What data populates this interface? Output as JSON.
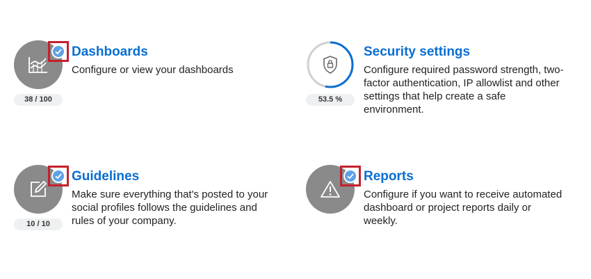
{
  "colors": {
    "accent": "#0a6ed1",
    "badge_gray": "#8a8a8a",
    "check_blue": "#5ea2e6",
    "highlight_red": "#c4202e",
    "progress_track": "#d0d0d0"
  },
  "cards": [
    {
      "title": "Dashboards",
      "description": "Configure or view your dashboards",
      "progress_label": "38 / 100",
      "icon": "area-chart-icon",
      "checked": true
    },
    {
      "title": "Security settings",
      "description": "Configure required password strength, two-factor authentication, IP allowlist and other settings that help create a safe environment.",
      "progress_label": "53.5 %",
      "progress_fraction": 0.535,
      "icon": "shield-lock-icon",
      "checked": false
    },
    {
      "title": "Guidelines",
      "description": "Make sure everything that's posted to your social profiles follows the guidelines and rules of your company.",
      "progress_label": "10 / 10",
      "icon": "edit-icon",
      "checked": true
    },
    {
      "title": "Reports",
      "description": "Configure if you want to receive automated dashboard or project reports daily or weekly.",
      "icon": "warning-icon",
      "checked": true
    }
  ]
}
